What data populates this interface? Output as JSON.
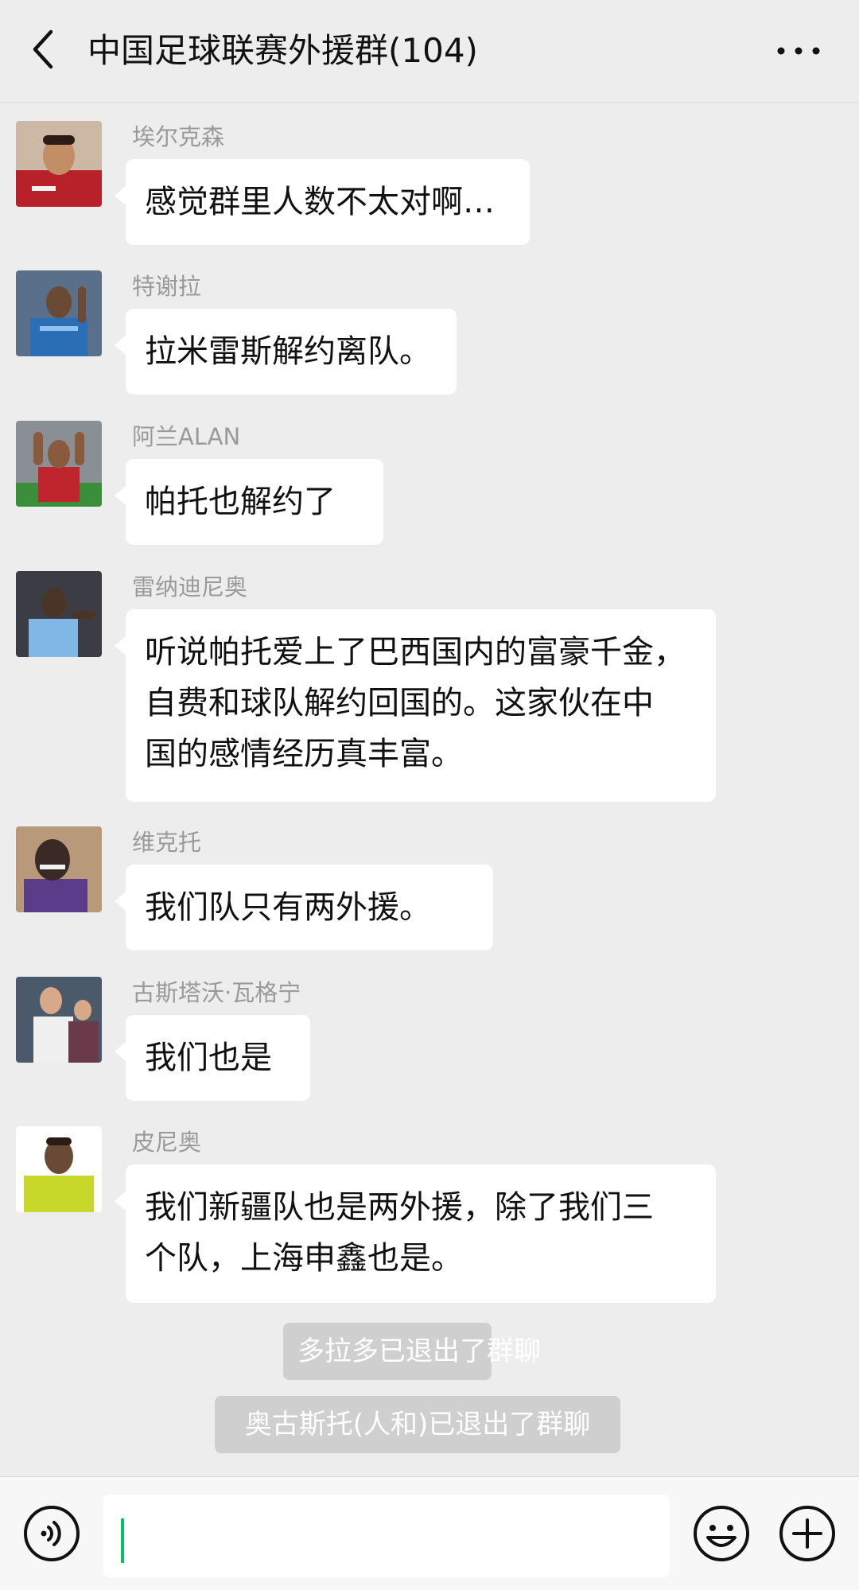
{
  "header": {
    "title": "中国足球联赛外援群(104)",
    "back_icon": "chevron-left-icon",
    "more_icon": "more-dots-icon"
  },
  "messages": [
    {
      "sender": "埃尔克森",
      "text": "感觉群里人数不太对啊…",
      "avatar_colors": [
        "#b8202a",
        "#f2c9a0"
      ]
    },
    {
      "sender": "特谢拉",
      "text": "拉米雷斯解约离队。",
      "avatar_colors": [
        "#2a6fb5",
        "#6b4a35"
      ]
    },
    {
      "sender": "阿兰ALAN",
      "text": "帕托也解约了",
      "avatar_colors": [
        "#c0242c",
        "#3b8f3b"
      ]
    },
    {
      "sender": "雷纳迪尼奥",
      "text_lines": [
        "听说帕托爱上了巴西国内的富豪千金，",
        "自费和球队解约回国的。这家伙在中",
        "国的感情经历真丰富。"
      ],
      "avatar_colors": [
        "#7fb8e6",
        "#4a3426"
      ]
    },
    {
      "sender": "维克托",
      "text": "我们队只有两外援。",
      "avatar_colors": [
        "#3a2a25",
        "#5a3c8a"
      ]
    },
    {
      "sender": "古斯塔沃·瓦格宁",
      "text": "我们也是",
      "avatar_colors": [
        "#f0f0f0",
        "#6a3a4a"
      ]
    },
    {
      "sender": "皮尼奥",
      "text_lines": [
        "我们新疆队也是两外援，除了我们三",
        "个队，上海申鑫也是。"
      ],
      "avatar_colors": [
        "#c8d82a",
        "#6b4a35"
      ]
    }
  ],
  "system_messages": [
    "多拉多已退出了群聊",
    "奥古斯托(人和)已退出了群聊"
  ],
  "bottom_bar": {
    "voice_icon": "voice-icon",
    "emoji_icon": "emoji-icon",
    "plus_icon": "plus-icon",
    "input_value": "",
    "cursor_color": "#07c160"
  }
}
